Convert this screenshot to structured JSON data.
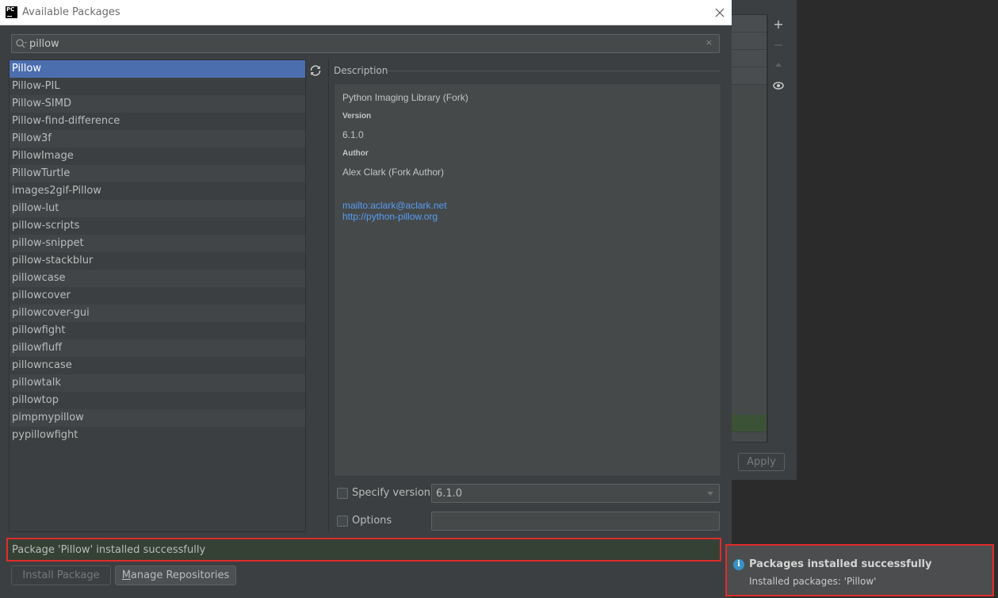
{
  "window": {
    "title": "Available Packages",
    "app_icon_text": "PC"
  },
  "search": {
    "value": "pillow"
  },
  "packages": [
    "Pillow",
    "Pillow-PIL",
    "Pillow-SIMD",
    "Pillow-find-difference",
    "Pillow3f",
    "PillowImage",
    "PillowTurtle",
    "images2gif-Pillow",
    "pillow-lut",
    "pillow-scripts",
    "pillow-snippet",
    "pillow-stackblur",
    "pillowcase",
    "pillowcover",
    "pillowcover-gui",
    "pillowfight",
    "pillowfluff",
    "pillowncase",
    "pillowtalk",
    "pillowtop",
    "pimpmypillow",
    "pypillowfight"
  ],
  "selected_package_index": 0,
  "description": {
    "label": "Description",
    "summary": "Python Imaging Library (Fork)",
    "version_heading": "Version",
    "version": "6.1.0",
    "author_heading": "Author",
    "author": "Alex Clark (Fork Author)",
    "link_email": "mailto:aclark@aclark.net",
    "link_home": "http://python-pillow.org"
  },
  "options": {
    "specify_version_label": "Specify version",
    "specify_version_checked": false,
    "version_value": "6.1.0",
    "options_label": "Options",
    "options_checked": false,
    "options_value": ""
  },
  "status": {
    "message": "Package 'Pillow' installed successfully"
  },
  "buttons": {
    "install": "Install Package",
    "manage_prefix": "M",
    "manage_rest": "anage Repositories",
    "apply": "Apply"
  },
  "notification": {
    "title": "Packages installed successfully",
    "body": "Installed packages: 'Pillow'"
  },
  "colors": {
    "selection": "#4b6eaf",
    "link": "#589df6",
    "highlight_border": "#e02b2b",
    "status_bg": "#344134",
    "info_icon": "#3592c4"
  }
}
